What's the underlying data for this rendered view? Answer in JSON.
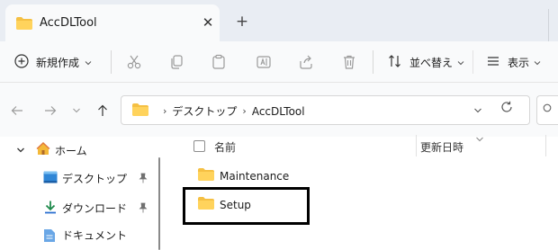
{
  "window": {
    "tab_title": "AccDLTool",
    "tab_close": "✕",
    "tab_add": "+"
  },
  "toolbar": {
    "new_label": "新規作成",
    "sort_label": "並べ替え",
    "view_label": "表示",
    "icons": [
      "cut-icon",
      "copy-icon",
      "paste-icon",
      "rename-icon",
      "share-icon",
      "delete-icon"
    ]
  },
  "address": {
    "crumbs": [
      "デスクトップ",
      "AccDLTool"
    ]
  },
  "nav_pane": {
    "items": [
      {
        "label": "ホーム",
        "icon": "home-icon"
      },
      {
        "label": "デスクトップ",
        "icon": "desktop-icon",
        "pinned": true
      },
      {
        "label": "ダウンロード",
        "icon": "download-icon",
        "pinned": true
      },
      {
        "label": "ドキュメント",
        "icon": "documents-icon"
      }
    ]
  },
  "file_list": {
    "columns": [
      "名前",
      "更新日時"
    ],
    "rows": [
      {
        "name": "Maintenance",
        "type": "folder"
      },
      {
        "name": "Setup",
        "type": "folder"
      }
    ]
  },
  "colors": {
    "folder": "#f5c043",
    "accent": "#0067c0",
    "annotation_box": "#000000"
  }
}
